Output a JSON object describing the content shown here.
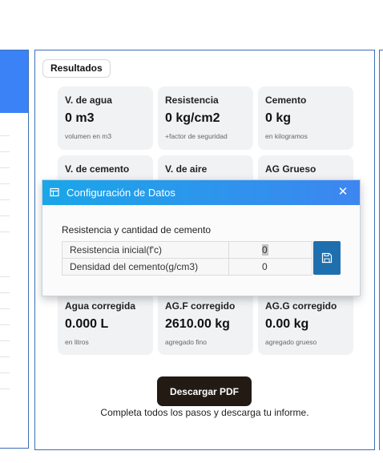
{
  "results": {
    "label": "Resultados",
    "cards": [
      {
        "title": "V. de agua",
        "value": "0 m3",
        "sub": "volumen en m3"
      },
      {
        "title": "Resistencia",
        "value": "0 kg/cm2",
        "sub": "+factor de seguridad"
      },
      {
        "title": "Cemento",
        "value": "0 kg",
        "sub": "en kilogramos"
      },
      {
        "title": "V. de cemento",
        "value": "",
        "sub": ""
      },
      {
        "title": "V. de aire",
        "value": "",
        "sub": ""
      },
      {
        "title": "AG Grueso",
        "value": "",
        "sub": ""
      },
      {
        "title": "Agua corregida",
        "value": "0.000 L",
        "sub": "en litros"
      },
      {
        "title": "AG.F corregido",
        "value": "2610.00 kg",
        "sub": "agregado fino"
      },
      {
        "title": "AG.G corregido",
        "value": "0.00 kg",
        "sub": "agregado grueso"
      }
    ],
    "download_label": "Descargar PDF",
    "footer": "Completa todos los pasos y descarga tu informe."
  },
  "modal": {
    "title": "Configuración de Datos",
    "close_glyph": "✕",
    "section_title": "Resistencia y cantidad de cemento",
    "rows": [
      {
        "label": "Resistencia inicial(f'c)",
        "value": "0"
      },
      {
        "label": "Densidad del cemento(g/cm3)",
        "value": "0"
      }
    ]
  },
  "colors": {
    "accent": "#3b82f6",
    "header_gradient_start": "#1aa6e8",
    "save_button": "#1f6fae",
    "download_button": "#231a14",
    "card_bg": "#f1f2f4"
  },
  "icons": {
    "header": "window-icon",
    "save": "floppy-disk-icon",
    "close": "close-icon"
  }
}
